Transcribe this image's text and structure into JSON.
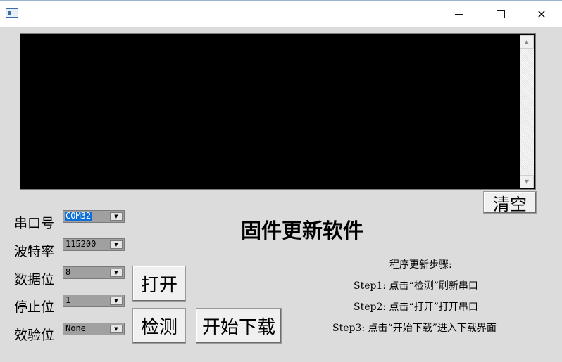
{
  "window": {
    "minimize_glyph": "",
    "maximize_glyph": "",
    "close_glyph": "✕"
  },
  "console": {
    "text": ""
  },
  "buttons": {
    "clear": "清空",
    "open": "打开",
    "detect": "检测",
    "start_download": "开始下载"
  },
  "settings": {
    "port": {
      "label": "串口号",
      "value": "COM32"
    },
    "baud": {
      "label": "波特率",
      "value": "115200"
    },
    "data_bits": {
      "label": "数据位",
      "value": "8"
    },
    "stop_bits": {
      "label": "停止位",
      "value": "1"
    },
    "parity": {
      "label": "效验位",
      "value": "None"
    }
  },
  "main_title": "固件更新软件",
  "instructions": {
    "title": "程序更新步骤:",
    "steps": [
      "Step1: 点击“检测”刷新串口",
      "Step2: 点击“打开”打开串口",
      "Step3: 点击“开始下载”进入下载界面"
    ]
  },
  "icons": [
    "app-window-icon",
    "minimize-icon",
    "maximize-icon",
    "close-icon",
    "scroll-up-icon",
    "scroll-down-icon",
    "dropdown-arrow-icon"
  ],
  "colors": {
    "console_bg": "#000000",
    "selection": "#0a6ed6",
    "window_bg": "#dcdcdc"
  }
}
